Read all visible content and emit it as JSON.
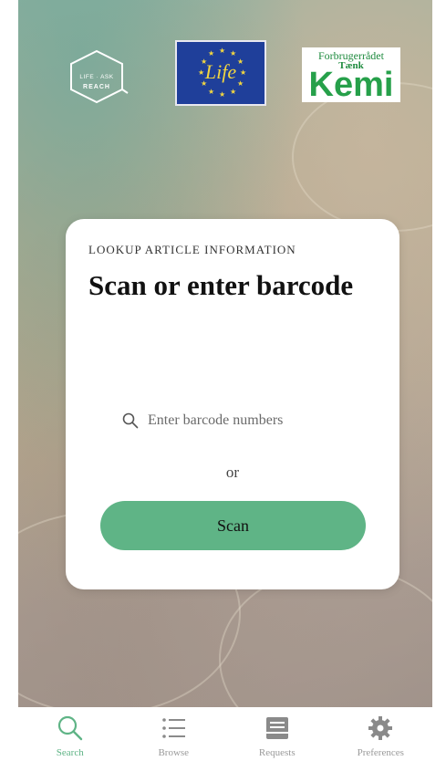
{
  "logos": {
    "reach": {
      "line1": "LIFE · ASK",
      "line2": "REACH"
    },
    "eu_life": {
      "text": "Life"
    },
    "kemi": {
      "top": "Forbrugerrådet",
      "middle": "Tænk",
      "big": "Kemi"
    }
  },
  "card": {
    "eyebrow": "LOOKUP ARTICLE INFORMATION",
    "title": "Scan or enter barcode",
    "search_placeholder": "Enter barcode numbers",
    "or_label": "or",
    "scan_label": "Scan"
  },
  "tabbar": {
    "tabs": [
      {
        "label": "Search",
        "icon": "search-icon",
        "active": true
      },
      {
        "label": "Browse",
        "icon": "list-icon",
        "active": false
      },
      {
        "label": "Requests",
        "icon": "inbox-icon",
        "active": false
      },
      {
        "label": "Preferences",
        "icon": "gear-icon",
        "active": false
      }
    ]
  },
  "colors": {
    "accent": "#5fb486",
    "eu_blue": "#1f3f9a",
    "kemi_green": "#26a04a"
  }
}
